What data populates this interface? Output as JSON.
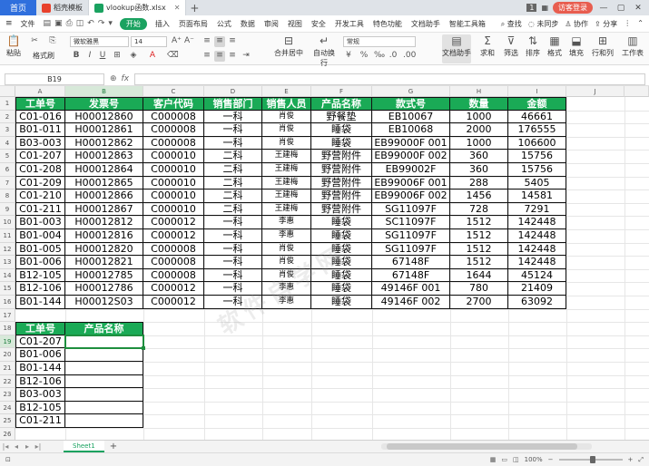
{
  "tabs": {
    "home": "首页",
    "tab1": "稻壳模板",
    "tab2": "vlookup函数.xlsx",
    "page_badge": "1",
    "visitor": "访客登录"
  },
  "menu": {
    "file": "文件",
    "start": "开始",
    "items": [
      "插入",
      "页面布局",
      "公式",
      "数据",
      "审阅",
      "视图",
      "安全",
      "开发工具",
      "特色功能",
      "文档助手",
      "智能工具箱"
    ],
    "search": "查找",
    "sync": "未同步",
    "collab": "协作",
    "share": "分享"
  },
  "ribbon": {
    "paste": "粘贴",
    "format_painter": "格式刷",
    "font_name": "微软雅黑",
    "font_size": "14",
    "merge": "合并居中",
    "wrap": "自动换行",
    "number_format": "常规",
    "doc_assistant": "文档助手",
    "sum": "求和",
    "filter": "筛选",
    "sort": "排序",
    "format": "格式",
    "fill": "填充",
    "rowcol": "行和列",
    "worksheet": "工作表"
  },
  "formula": {
    "namebox": "B19"
  },
  "columns": [
    "A",
    "B",
    "C",
    "D",
    "E",
    "F",
    "G",
    "H",
    "I",
    "J"
  ],
  "rows": [
    "1",
    "2",
    "3",
    "4",
    "5",
    "6",
    "7",
    "8",
    "9",
    "10",
    "11",
    "12",
    "13",
    "14",
    "15",
    "16",
    "17",
    "18",
    "19",
    "20",
    "21",
    "22",
    "23",
    "24",
    "25",
    "26"
  ],
  "table": {
    "headers": [
      "工单号",
      "发票号",
      "客户代码",
      "销售部门",
      "销售人员",
      "产品名称",
      "款式号",
      "数量",
      "金额"
    ],
    "rows": [
      [
        "C01-016",
        "H00012860",
        "C000008",
        "一科",
        "肖俊",
        "野餐垫",
        "EB10067",
        "1000",
        "46661"
      ],
      [
        "B01-011",
        "H00012861",
        "C000008",
        "一科",
        "肖俊",
        "睡袋",
        "EB10068",
        "2000",
        "176555"
      ],
      [
        "B03-003",
        "H00012862",
        "C000008",
        "一科",
        "肖俊",
        "睡袋",
        "EB99000F 001",
        "1000",
        "106600"
      ],
      [
        "C01-207",
        "H00012863",
        "C000010",
        "二科",
        "王建梅",
        "野营附件",
        "EB99000F 002",
        "360",
        "15756"
      ],
      [
        "C01-208",
        "H00012864",
        "C000010",
        "二科",
        "王建梅",
        "野营附件",
        "EB99002F",
        "360",
        "15756"
      ],
      [
        "C01-209",
        "H00012865",
        "C000010",
        "二科",
        "王建梅",
        "野营附件",
        "EB99006F 001",
        "288",
        "5405"
      ],
      [
        "C01-210",
        "H00012866",
        "C000010",
        "二科",
        "王建梅",
        "野营附件",
        "EB99006F 002",
        "1456",
        "14581"
      ],
      [
        "C01-211",
        "H00012867",
        "C000010",
        "二科",
        "王建梅",
        "野营附件",
        "SG11097F",
        "728",
        "7291"
      ],
      [
        "B01-003",
        "H00012812",
        "C000012",
        "一科",
        "李惠",
        "睡袋",
        "SC11097F",
        "1512",
        "142448"
      ],
      [
        "B01-004",
        "H00012816",
        "C000012",
        "一科",
        "李惠",
        "睡袋",
        "SG11097F",
        "1512",
        "142448"
      ],
      [
        "B01-005",
        "H00012820",
        "C000008",
        "一科",
        "肖俊",
        "睡袋",
        "SG11097F",
        "1512",
        "142448"
      ],
      [
        "B01-006",
        "H00012821",
        "C000008",
        "一科",
        "肖俊",
        "睡袋",
        "67148F",
        "1512",
        "142448"
      ],
      [
        "B12-105",
        "H00012785",
        "C000008",
        "一科",
        "肖俊",
        "睡袋",
        "67148F",
        "1644",
        "45124"
      ],
      [
        "B12-106",
        "H00012786",
        "C000012",
        "一科",
        "李惠",
        "睡袋",
        "49146F 001",
        "780",
        "21409"
      ],
      [
        "B01-144",
        "H00012S03",
        "C000012",
        "一科",
        "李惠",
        "睡袋",
        "49146F 002",
        "2700",
        "63092"
      ]
    ]
  },
  "lookup": {
    "headers": [
      "工单号",
      "产品名称"
    ],
    "ids": [
      "C01-207",
      "B01-006",
      "B01-144",
      "B12-106",
      "B03-003",
      "B12-105",
      "C01-211"
    ]
  },
  "sheet": {
    "tab": "Sheet1"
  },
  "status": {
    "zoom": "100%"
  }
}
